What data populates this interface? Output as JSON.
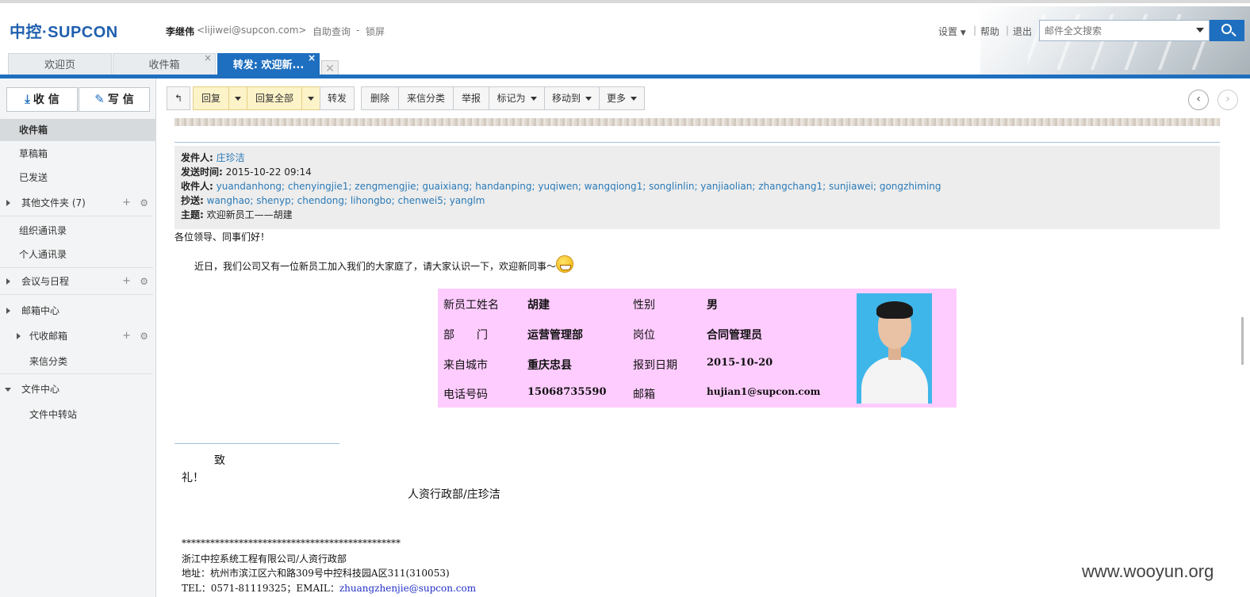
{
  "brand": {
    "logo_text": "中控·SUPCON"
  },
  "user": {
    "name": "李继伟",
    "email": "<lijiwei@supcon.com>"
  },
  "top_links": {
    "self_query": "自助查询",
    "dash": "-",
    "lock": "锁屏"
  },
  "top_right": {
    "settings": "设置",
    "sep1": "|",
    "help": "帮助",
    "sep2": "|",
    "logout": "退出"
  },
  "search": {
    "placeholder": "邮件全文搜索"
  },
  "tabs": [
    {
      "label": "欢迎页"
    },
    {
      "label": "收件箱",
      "close": "×"
    },
    {
      "label": "转发: 欢迎新...",
      "close": "×"
    }
  ],
  "tab_ghost": "✕",
  "sidebar": {
    "receive_label": "收 信",
    "compose_label": "写 信",
    "items": {
      "inbox": "收件箱",
      "drafts": "草稿箱",
      "sent": "已发送",
      "other_folders": "其他文件夹 (7)",
      "org_contacts": "组织通讯录",
      "personal_contacts": "个人通讯录",
      "meetings": "会议与日程",
      "mail_center": "邮箱中心",
      "proxy_mailbox": "代收邮箱",
      "incoming_categories": "来信分类",
      "file_center": "文件中心",
      "file_transfer": "文件中转站"
    },
    "plus": "+",
    "gear": "⚙"
  },
  "toolbar": {
    "back_icon": "↰",
    "reply": "回复",
    "reply_all": "回复全部",
    "forward": "转发",
    "delete": "删除",
    "classify": "来信分类",
    "report": "举报",
    "mark_as": "标记为",
    "move_to": "移动到",
    "more": "更多",
    "prev": "‹",
    "next": "›"
  },
  "mail_header": {
    "from_label": "发件人:",
    "from": "庄珍洁",
    "time_label": "发送时间:",
    "time": "2015-10-22 09:14",
    "to_label": "收件人:",
    "to": "yuandanhong; chenyingjie1; zengmengjie; guaixiang; handanping; yuqiwen; wangqiong1; songlinlin; yanjiaolian; zhangchang1; sunjiawei; gongzhiming",
    "cc_label": "抄送:",
    "cc": "wanghao; shenyp; chendong; lihongbo; chenwei5; yanglm",
    "subject_label": "主题:",
    "subject": "欢迎新员工——胡建"
  },
  "mail_body": {
    "greeting": "各位领导、同事们好！",
    "intro": "近日，我们公司又有一位新员工加入我们的大家庭了，请大家认识一下，欢迎新同事～",
    "closing_1": "致",
    "closing_2": "礼！",
    "signature": "人资行政部/庄珍洁",
    "stars": "**********************************************",
    "company": "浙江中控系统工程有限公司/人资行政部",
    "address": "地址：杭州市滨江区六和路309号中控科技园A区311(310053)",
    "contact_prefix": "TEL：0571-81119325；EMAIL：",
    "contact_email": "zhuangzhenjie@supcon.com"
  },
  "employee": {
    "name_label": "新员工姓名",
    "name": "胡建",
    "gender_label": "性别",
    "gender": "男",
    "dept_label": "部　　门",
    "dept": "运营管理部",
    "position_label": "岗位",
    "position": "合同管理员",
    "city_label": "来自城市",
    "city": "重庆忠县",
    "date_label": "报到日期",
    "date": "2015-10-20",
    "phone_label": "电话号码",
    "phone": "15068735590",
    "email_label": "邮箱",
    "email": "hujian1@supcon.com"
  },
  "watermark": "www.wooyun.org",
  "colors": {
    "accent": "#1e6fbf",
    "link": "#2a7ab7",
    "card_bg": "#ffccff",
    "reply_yellow": "#fdf3c8"
  }
}
